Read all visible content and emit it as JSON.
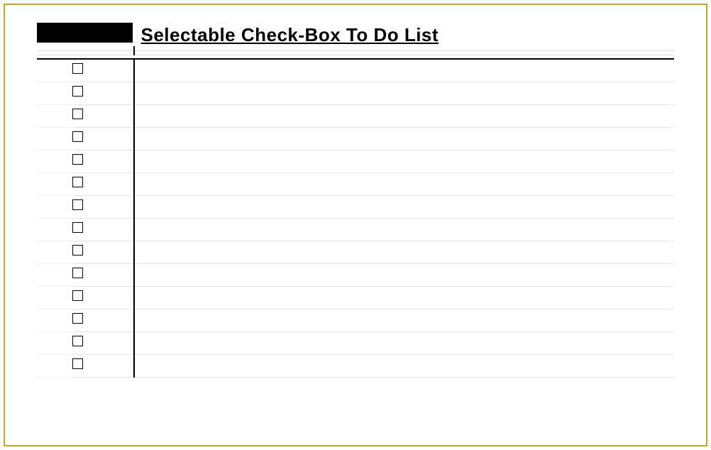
{
  "title": "Selectable Check-Box To Do List",
  "rows": [
    {
      "checked": false,
      "task": ""
    },
    {
      "checked": false,
      "task": ""
    },
    {
      "checked": false,
      "task": ""
    },
    {
      "checked": false,
      "task": ""
    },
    {
      "checked": false,
      "task": ""
    },
    {
      "checked": false,
      "task": ""
    },
    {
      "checked": false,
      "task": ""
    },
    {
      "checked": false,
      "task": ""
    },
    {
      "checked": false,
      "task": ""
    },
    {
      "checked": false,
      "task": ""
    },
    {
      "checked": false,
      "task": ""
    },
    {
      "checked": false,
      "task": ""
    },
    {
      "checked": false,
      "task": ""
    },
    {
      "checked": false,
      "task": ""
    }
  ]
}
